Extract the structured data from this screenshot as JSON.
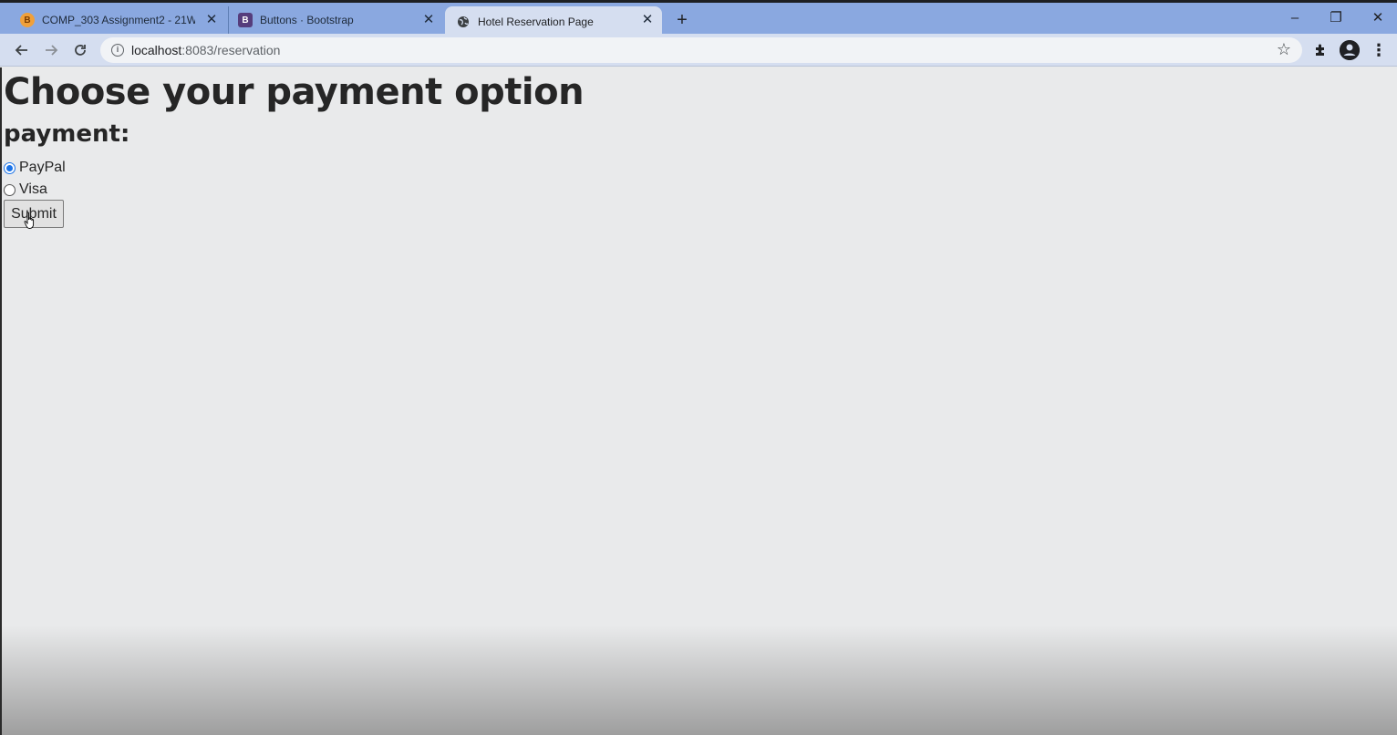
{
  "browser": {
    "tabs": [
      {
        "title": "COMP_303 Assignment2 - 21W -",
        "icon": "blogger-icon",
        "active": false
      },
      {
        "title": "Buttons · Bootstrap",
        "icon": "bootstrap-icon",
        "active": false
      },
      {
        "title": "Hotel Reservation Page",
        "icon": "globe-icon",
        "active": true
      }
    ],
    "new_tab_symbol": "+",
    "window_controls": {
      "minimize": "–",
      "restore": "❐",
      "close": "✕"
    },
    "address": {
      "host": "localhost",
      "path": ":8083/reservation"
    },
    "toolbar_icons": [
      "back-icon",
      "forward-icon",
      "reload-icon",
      "info-icon",
      "star-icon",
      "extensions-icon",
      "account-icon",
      "menu-icon"
    ]
  },
  "page": {
    "heading": "Choose your payment option",
    "subheading": "payment:",
    "options": [
      {
        "label": "PayPal",
        "checked": true
      },
      {
        "label": "Visa",
        "checked": false
      }
    ],
    "submit_label": "Submit"
  },
  "colors": {
    "tabstrip": "#8aa8e0",
    "active_tab": "#d5def0",
    "page_bg": "#e9eaeb",
    "radio_accent": "#1a73e8"
  }
}
